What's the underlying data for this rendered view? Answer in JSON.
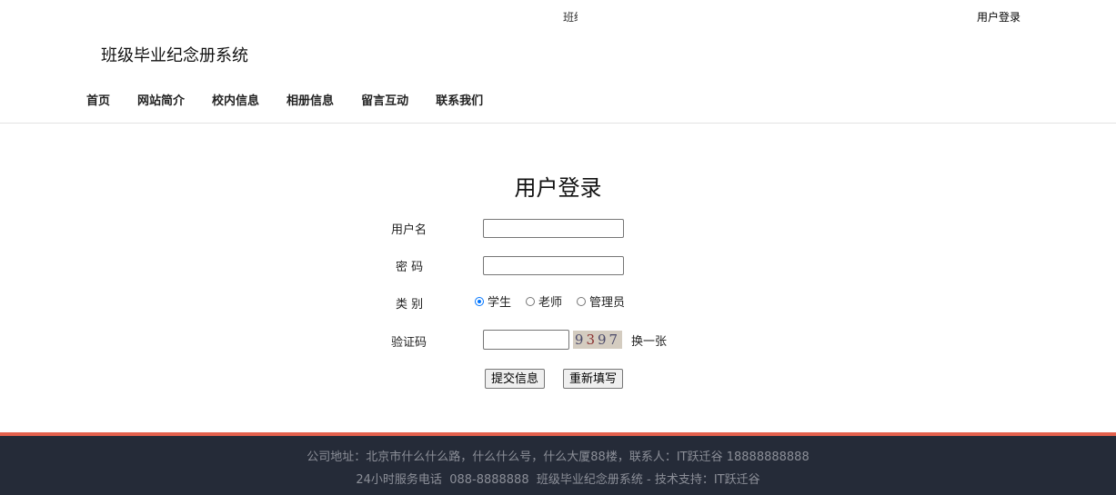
{
  "topbar": {
    "marquee_fragment": "班级",
    "login_link": "用户登录"
  },
  "site": {
    "title": "班级毕业纪念册系统"
  },
  "nav": {
    "items": [
      "首页",
      "网站简介",
      "校内信息",
      "相册信息",
      "留言互动",
      "联系我们"
    ]
  },
  "login": {
    "title": "用户登录",
    "username_label": "用户名",
    "username_value": "",
    "password_label": "密 码",
    "password_value": "",
    "category_label": "类 别",
    "categories": [
      {
        "label": "学生",
        "selected": true
      },
      {
        "label": "老师",
        "selected": false
      },
      {
        "label": "管理员",
        "selected": false
      }
    ],
    "captcha_label": "验证码",
    "captcha_value": "",
    "captcha_chars": [
      "9",
      "3",
      "9",
      "7"
    ],
    "captcha_refresh": "换一张",
    "submit_label": "提交信息",
    "reset_label": "重新填写"
  },
  "footer": {
    "line1": "公司地址：北京市什么什么路，什么什么号，什么大厦88楼，联系人：IT跃迁谷 18888888888",
    "line2": "24小时服务电话  088-8888888  班级毕业纪念册系统 - 技术支持：IT跃迁谷"
  },
  "colors": {
    "footer_bg": "#252b38",
    "footer_accent": "#e4614d",
    "radio_accent": "#0075ff"
  }
}
